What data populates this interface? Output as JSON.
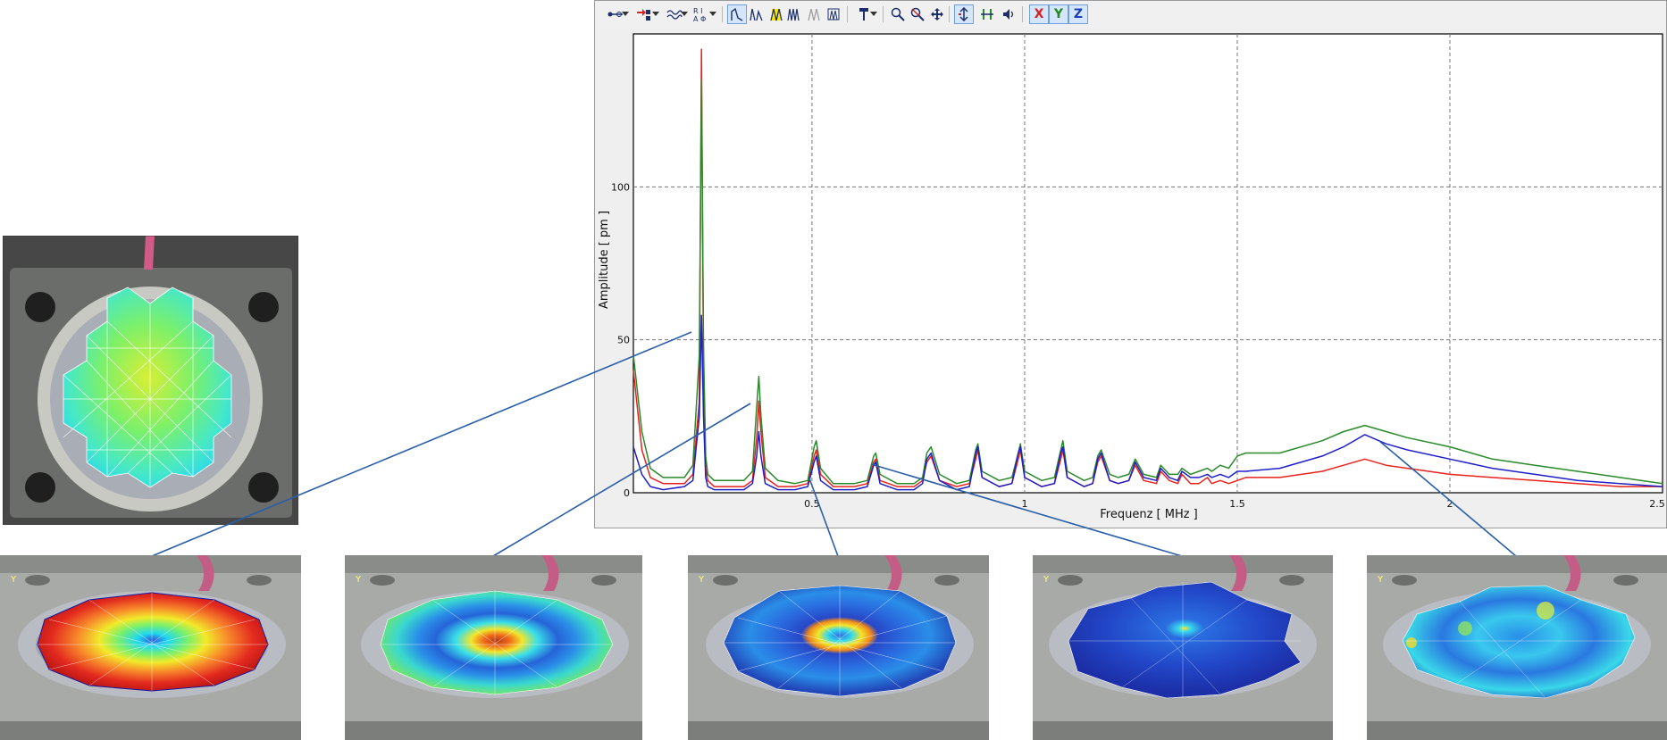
{
  "toolbar": {
    "axis_buttons": [
      "X",
      "Y",
      "Z"
    ]
  },
  "chart_data": {
    "type": "line",
    "xlabel": "Frequenz [ MHz ]",
    "ylabel": "Amplitude [ pm ]",
    "xlim": [
      0.08,
      2.5
    ],
    "ylim": [
      0,
      150
    ],
    "x_ticks": [
      0.5,
      1,
      1.5,
      2,
      2.5
    ],
    "x_tick_labels": [
      "0.5",
      "1",
      "1.5",
      "2",
      "2.5"
    ],
    "y_ticks": [
      0,
      50,
      100
    ],
    "y_tick_labels": [
      "0",
      "50",
      "100"
    ],
    "grid": true,
    "series": [
      {
        "color": "#e8231e",
        "x": [
          0.08,
          0.1,
          0.12,
          0.15,
          0.2,
          0.22,
          0.235,
          0.24,
          0.245,
          0.25,
          0.255,
          0.27,
          0.3,
          0.34,
          0.36,
          0.37,
          0.375,
          0.38,
          0.39,
          0.42,
          0.46,
          0.49,
          0.505,
          0.51,
          0.52,
          0.55,
          0.6,
          0.63,
          0.645,
          0.65,
          0.66,
          0.7,
          0.74,
          0.76,
          0.77,
          0.78,
          0.8,
          0.84,
          0.87,
          0.885,
          0.89,
          0.9,
          0.94,
          0.97,
          0.985,
          0.99,
          1.0,
          1.04,
          1.07,
          1.085,
          1.09,
          1.1,
          1.14,
          1.16,
          1.172,
          1.18,
          1.2,
          1.22,
          1.245,
          1.26,
          1.28,
          1.31,
          1.32,
          1.34,
          1.36,
          1.37,
          1.39,
          1.41,
          1.43,
          1.44,
          1.46,
          1.48,
          1.5,
          1.52,
          1.6,
          1.7,
          1.75,
          1.8,
          1.85,
          1.9,
          2.0,
          2.1,
          2.2,
          2.3,
          2.4,
          2.5
        ],
        "y": [
          40,
          14,
          5,
          3,
          3,
          6,
          30,
          145,
          40,
          8,
          4,
          2,
          2,
          2,
          4,
          18,
          30,
          20,
          5,
          2,
          2,
          3,
          12,
          14,
          6,
          2,
          2,
          3,
          10,
          11,
          4,
          2,
          2,
          4,
          10,
          12,
          4,
          2,
          3,
          11,
          14,
          5,
          2,
          3,
          11,
          14,
          5,
          2,
          3,
          11,
          14,
          5,
          2,
          3,
          10,
          12,
          4,
          3,
          4,
          9,
          4,
          3,
          7,
          4,
          3,
          6,
          3,
          3,
          5,
          3,
          4,
          3,
          4,
          5,
          5,
          7,
          9,
          11,
          9,
          8,
          6,
          5,
          4,
          3,
          2,
          2
        ]
      },
      {
        "color": "#2a8a2a",
        "x": [
          0.08,
          0.1,
          0.12,
          0.15,
          0.2,
          0.22,
          0.235,
          0.24,
          0.245,
          0.25,
          0.255,
          0.27,
          0.3,
          0.34,
          0.36,
          0.37,
          0.375,
          0.38,
          0.39,
          0.42,
          0.46,
          0.49,
          0.505,
          0.51,
          0.52,
          0.55,
          0.6,
          0.63,
          0.645,
          0.65,
          0.66,
          0.7,
          0.74,
          0.76,
          0.77,
          0.78,
          0.8,
          0.84,
          0.87,
          0.885,
          0.89,
          0.9,
          0.94,
          0.97,
          0.985,
          0.99,
          1.0,
          1.04,
          1.07,
          1.085,
          1.09,
          1.1,
          1.14,
          1.16,
          1.172,
          1.18,
          1.2,
          1.22,
          1.245,
          1.26,
          1.28,
          1.31,
          1.32,
          1.34,
          1.36,
          1.37,
          1.39,
          1.41,
          1.43,
          1.44,
          1.46,
          1.48,
          1.5,
          1.52,
          1.6,
          1.7,
          1.75,
          1.8,
          1.85,
          1.9,
          2.0,
          2.1,
          2.2,
          2.3,
          2.4,
          2.5
        ],
        "y": [
          45,
          20,
          8,
          5,
          5,
          9,
          45,
          135,
          48,
          12,
          6,
          4,
          4,
          4,
          7,
          28,
          38,
          25,
          8,
          4,
          3,
          4,
          15,
          17,
          8,
          3,
          3,
          4,
          12,
          13,
          6,
          3,
          3,
          5,
          13,
          15,
          6,
          3,
          4,
          14,
          16,
          7,
          4,
          5,
          13,
          16,
          7,
          4,
          5,
          14,
          17,
          7,
          4,
          5,
          12,
          14,
          6,
          5,
          6,
          11,
          6,
          5,
          9,
          6,
          6,
          8,
          6,
          7,
          8,
          7,
          9,
          8,
          12,
          13,
          13,
          17,
          20,
          22,
          20,
          18,
          15,
          11,
          9,
          7,
          5,
          3
        ]
      },
      {
        "color": "#1f1fc8",
        "x": [
          0.08,
          0.1,
          0.12,
          0.15,
          0.2,
          0.22,
          0.235,
          0.24,
          0.245,
          0.25,
          0.255,
          0.27,
          0.3,
          0.34,
          0.36,
          0.37,
          0.375,
          0.38,
          0.39,
          0.42,
          0.46,
          0.49,
          0.505,
          0.51,
          0.52,
          0.55,
          0.6,
          0.63,
          0.645,
          0.65,
          0.66,
          0.7,
          0.74,
          0.76,
          0.77,
          0.78,
          0.8,
          0.84,
          0.87,
          0.885,
          0.89,
          0.9,
          0.94,
          0.97,
          0.985,
          0.99,
          1.0,
          1.04,
          1.07,
          1.085,
          1.09,
          1.1,
          1.14,
          1.16,
          1.172,
          1.18,
          1.2,
          1.22,
          1.245,
          1.26,
          1.28,
          1.31,
          1.32,
          1.34,
          1.36,
          1.37,
          1.39,
          1.41,
          1.43,
          1.44,
          1.46,
          1.48,
          1.5,
          1.52,
          1.6,
          1.7,
          1.75,
          1.8,
          1.85,
          1.9,
          2.0,
          2.1,
          2.2,
          2.3,
          2.4,
          2.5
        ],
        "y": [
          15,
          6,
          2,
          1,
          2,
          4,
          25,
          58,
          25,
          5,
          2,
          1,
          1,
          1,
          3,
          12,
          20,
          12,
          3,
          1,
          1,
          2,
          10,
          12,
          4,
          1,
          1,
          2,
          9,
          10,
          3,
          1,
          1,
          3,
          11,
          13,
          4,
          1,
          2,
          13,
          15,
          5,
          2,
          3,
          13,
          15,
          5,
          2,
          3,
          13,
          15,
          5,
          2,
          3,
          11,
          13,
          4,
          3,
          4,
          10,
          5,
          4,
          8,
          5,
          4,
          7,
          5,
          5,
          6,
          5,
          6,
          5,
          7,
          7,
          8,
          12,
          15,
          19,
          16,
          14,
          11,
          8,
          6,
          4,
          3,
          2
        ]
      }
    ]
  }
}
